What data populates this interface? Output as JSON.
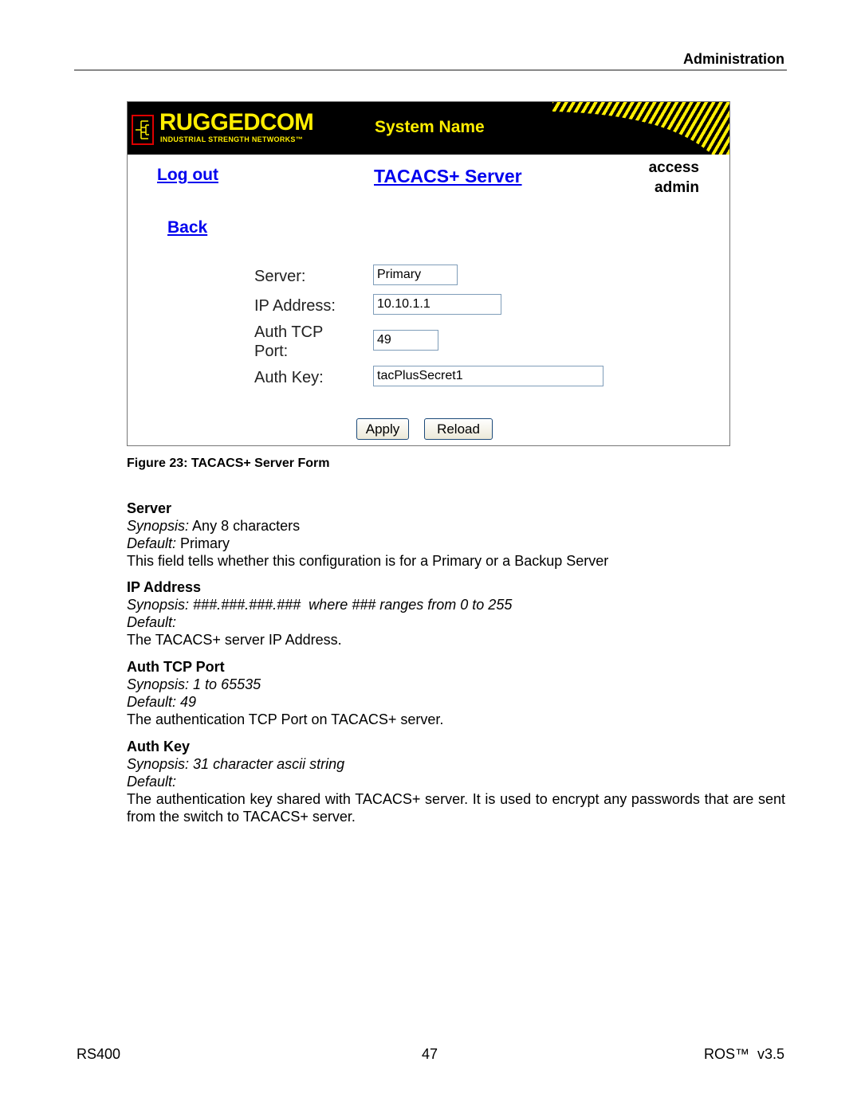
{
  "page_header": {
    "section": "Administration"
  },
  "figure": {
    "banner": {
      "brand": "RUGGEDCOM",
      "tagline": "INDUSTRIAL STRENGTH NETWORKS™",
      "system_name": "System Name",
      "colors": {
        "background": "#000000",
        "accent": "#ffee00",
        "logo_border": "#dd0000"
      }
    },
    "nav": {
      "logout": "Log out",
      "back": "Back",
      "page_title": "TACACS+ Server",
      "access_label": "access",
      "access_level": "admin",
      "link_color": "#0000ee"
    },
    "form": {
      "fields": [
        {
          "label": "Server:",
          "value": "Primary"
        },
        {
          "label": "IP Address:",
          "value": "10.10.1.1"
        },
        {
          "label": "Auth TCP Port:",
          "label_line1": "Auth TCP",
          "label_line2": "Port:",
          "value": "49"
        },
        {
          "label": "Auth Key:",
          "value": "tacPlusSecret1"
        }
      ],
      "apply_label": "Apply",
      "reload_label": "Reload"
    },
    "caption": "Figure 23: TACACS+ Server Form"
  },
  "sections": [
    {
      "heading": "Server",
      "synopsis_label": "Synopsis:",
      "synopsis": " Any 8 characters",
      "default_label": "Default:",
      "default": " Primary",
      "description": "This field tells whether this configuration is for a Primary or a Backup Server"
    },
    {
      "heading": "IP Address",
      "synopsis_label": "Synopsis:",
      "synopsis": " ###.###.###.###  where ### ranges from 0 to 255",
      "default_label": "Default:",
      "default": "",
      "description": "The TACACS+ server IP Address."
    },
    {
      "heading": "Auth TCP Port",
      "synopsis_label": "Synopsis:",
      "synopsis": " 1 to 65535",
      "default_label": "Default:",
      "default": " 49",
      "description": "The authentication TCP Port on TACACS+ server."
    },
    {
      "heading": "Auth Key",
      "synopsis_label": "Synopsis:",
      "synopsis": " 31 character ascii string",
      "default_label": "Default:",
      "default": "",
      "description": "The authentication key shared with TACACS+ server. It is used to encrypt any passwords that are sent from the switch to TACACS+ server."
    }
  ],
  "footer": {
    "left": "RS400",
    "center": "47",
    "right": "ROS™  v3.5"
  }
}
